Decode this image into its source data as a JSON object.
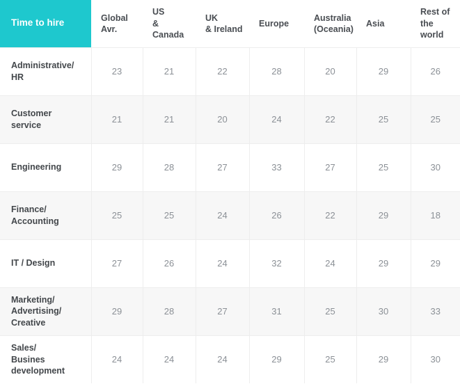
{
  "table": {
    "corner_label": "Time to hire",
    "accent_color": "#1ec8ce",
    "header_text_color": "#494d52",
    "row_label_color": "#43474b",
    "value_color": "#8b9096",
    "stripe_color": "#f7f7f7",
    "border_color": "#ededed",
    "columns": [
      "Global\nAvr.",
      "US\n& Canada",
      "UK\n& Ireland",
      "Europe",
      "Australia\n(Oceania)",
      "Asia",
      "Rest of\nthe world"
    ],
    "rows": [
      {
        "label": "Administrative/\nHR",
        "values": [
          "23",
          "21",
          "22",
          "28",
          "20",
          "29",
          "26"
        ]
      },
      {
        "label": "Customer\nservice",
        "values": [
          "21",
          "21",
          "20",
          "24",
          "22",
          "25",
          "25"
        ]
      },
      {
        "label": "Engineering",
        "values": [
          "29",
          "28",
          "27",
          "33",
          "27",
          "25",
          "30"
        ]
      },
      {
        "label": "Finance/\nAccounting",
        "values": [
          "25",
          "25",
          "24",
          "26",
          "22",
          "29",
          "18"
        ]
      },
      {
        "label": "IT / Design",
        "values": [
          "27",
          "26",
          "24",
          "32",
          "24",
          "29",
          "29"
        ]
      },
      {
        "label": "Marketing/\nAdvertising/\nCreative",
        "values": [
          "29",
          "28",
          "27",
          "31",
          "25",
          "30",
          "33"
        ]
      },
      {
        "label": "Sales/\nBusines\ndevelopment",
        "values": [
          "24",
          "24",
          "24",
          "29",
          "25",
          "29",
          "30"
        ]
      }
    ]
  }
}
